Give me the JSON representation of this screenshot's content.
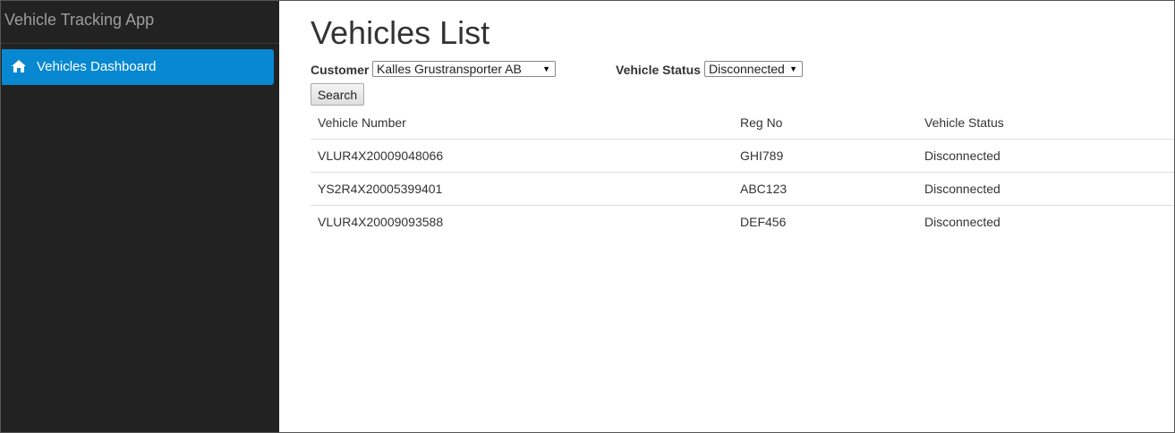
{
  "app": {
    "title": "Vehicle Tracking App"
  },
  "sidebar": {
    "items": [
      {
        "label": "Vehicles Dashboard",
        "icon": "home-icon",
        "active": true
      }
    ]
  },
  "main": {
    "title": "Vehicles List",
    "filters": {
      "customer_label": "Customer",
      "customer_value": "Kalles Grustransporter AB",
      "status_label": "Vehicle Status",
      "status_value": "Disconnected",
      "search_label": "Search"
    },
    "table": {
      "columns": [
        "Vehicle Number",
        "Reg No",
        "Vehicle Status"
      ],
      "rows": [
        [
          "VLUR4X20009048066",
          "GHI789",
          "Disconnected"
        ],
        [
          "YS2R4X20005399401",
          "ABC123",
          "Disconnected"
        ],
        [
          "VLUR4X20009093588",
          "DEF456",
          "Disconnected"
        ]
      ]
    }
  },
  "colors": {
    "sidebar_bg": "#222222",
    "active_item_bg": "#0788d1",
    "brand_text": "#9d9d9d"
  }
}
